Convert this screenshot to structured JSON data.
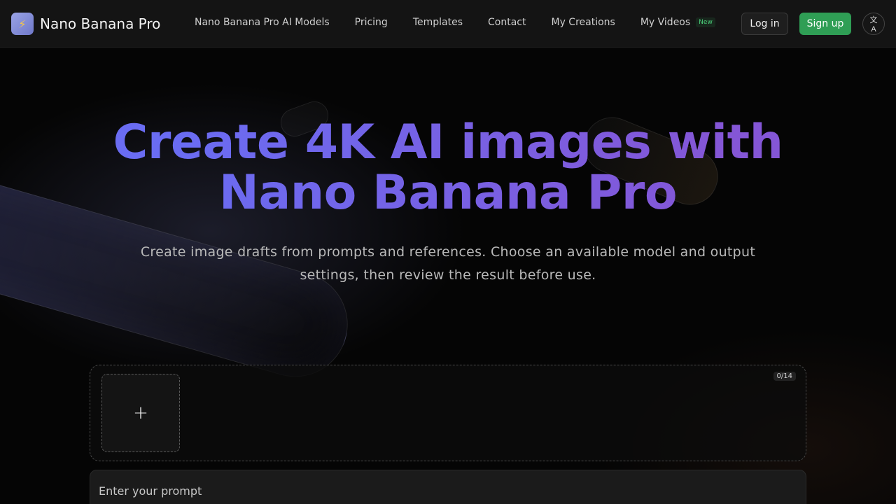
{
  "header": {
    "brand": "Nano Banana Pro",
    "logo_icon": "banana-bolt-icon",
    "nav": [
      {
        "label": "Nano Banana Pro AI Models"
      },
      {
        "label": "Pricing"
      },
      {
        "label": "Templates"
      },
      {
        "label": "Contact"
      },
      {
        "label": "My Creations"
      },
      {
        "label": "My Videos",
        "badge": "New"
      }
    ],
    "login_label": "Log in",
    "signup_label": "Sign up",
    "lang_icon": "translate-icon"
  },
  "hero": {
    "title_line1": "Create 4K AI images with",
    "title_line2": "Nano Banana Pro",
    "subtitle": "Create image drafts from prompts and references. Choose an available model and output settings, then review the result before use."
  },
  "upload": {
    "add_icon": "plus-icon",
    "count": "0/14"
  },
  "prompt": {
    "placeholder": "Enter your prompt"
  },
  "colors": {
    "accent_blue": "#6a6cf2",
    "accent_purple": "#8456d6",
    "signup_green": "#2f9e55",
    "badge_green": "#4bd07a"
  }
}
